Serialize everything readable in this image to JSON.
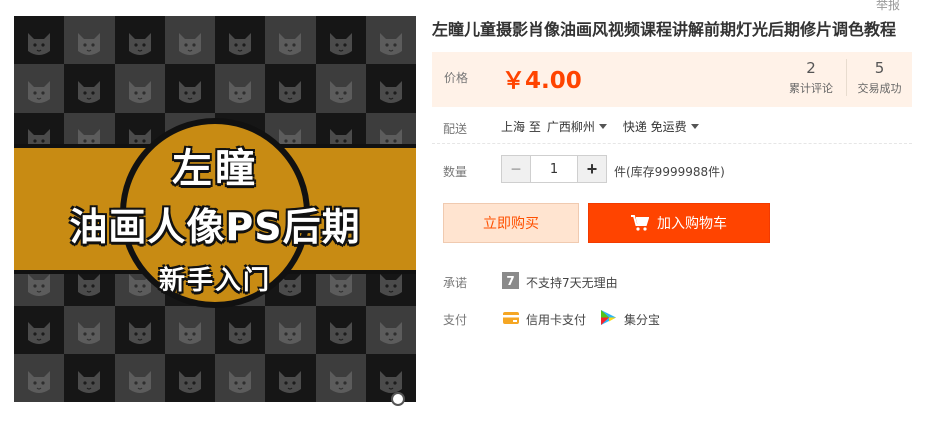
{
  "product": {
    "title": "左瞳儿童摄影肖像油画风视频课程讲解前期灯光后期修片调色教程",
    "report_link": "举报"
  },
  "image": {
    "title_line1": "左瞳",
    "title_line2": "油画人像PS后期",
    "title_line3": "新手入门",
    "tile_icon": "cat-face-icon",
    "banner_color": "#c88b13"
  },
  "price": {
    "label": "价格",
    "value": "￥4.00",
    "color": "#ff4400"
  },
  "stats": [
    {
      "value": "2",
      "label": "累计评论"
    },
    {
      "value": "5",
      "label": "交易成功"
    }
  ],
  "shipping": {
    "label": "配送",
    "from": "上海 至",
    "to": "广西柳州",
    "method": "快递 免运费"
  },
  "quantity": {
    "label": "数量",
    "value": "1",
    "minus_label": "−",
    "plus_label": "+",
    "stock": "件(库存9999988件)"
  },
  "buttons": {
    "buy_now": "立即购买",
    "add_to_cart": "加入购物车",
    "cart_icon": "shopping-cart-icon"
  },
  "promise": {
    "label": "承诺",
    "icon_text": "7",
    "text": "不支持7天无理由"
  },
  "payment": {
    "label": "支付",
    "methods": [
      {
        "icon": "credit-card-icon",
        "text": "信用卡支付"
      },
      {
        "icon": "jifenbao-icon",
        "text": "集分宝"
      }
    ]
  }
}
